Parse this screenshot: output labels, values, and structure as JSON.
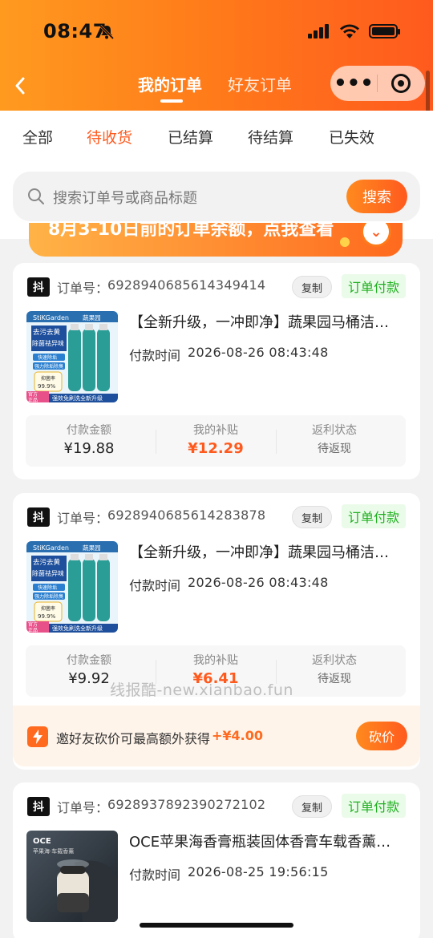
{
  "status_bar": {
    "time": "08:47"
  },
  "nav": {
    "tabs": [
      {
        "label": "我的订单",
        "active": true
      },
      {
        "label": "好友订单",
        "active": false
      }
    ]
  },
  "filter_tabs": [
    {
      "label": "全部"
    },
    {
      "label": "待收货",
      "active": true
    },
    {
      "label": "已结算"
    },
    {
      "label": "待结算"
    },
    {
      "label": "已失效"
    }
  ],
  "search": {
    "placeholder": "搜索订单号或商品标题",
    "button": "搜索"
  },
  "banner": {
    "text": "8月3-10日前的订单余额，点我查看"
  },
  "labels": {
    "order_no": "订单号：",
    "copy": "复制",
    "pay_time": "付款时间",
    "pay_amount": "付款金额",
    "subsidy": "我的补贴",
    "rebate_status": "返利状态",
    "platform_icon": "抖"
  },
  "orders": [
    {
      "order_no": "6928940685614349414",
      "status": "订单付款",
      "title": "【全新升级，一冲即净】蔬果园马桶洁…",
      "pay_time": "2026-08-26 08:43:48",
      "pay_amount": "¥19.88",
      "subsidy": "¥12.29",
      "rebate_status": "待返现"
    },
    {
      "order_no": "6928940685614283878",
      "status": "订单付款",
      "title": "【全新升级，一冲即净】蔬果园马桶洁…",
      "pay_time": "2026-08-26 08:43:48",
      "pay_amount": "¥9.92",
      "subsidy": "¥6.41",
      "rebate_status": "待返现"
    },
    {
      "order_no": "6928937892390272102",
      "status": "订单付款",
      "title": "OCE苹果海香膏瓶装固体香膏车载香薰…",
      "pay_time": "2026-08-25 19:56:15"
    }
  ],
  "product_image": {
    "brand": "StiKGarden",
    "brand_cn": "蔬果园",
    "line1": "去污去黄",
    "line2": "除菌祛异味",
    "tag1": "快速除垢",
    "tag2": "强力除垢除臭",
    "rate_label": "抑菌率",
    "rate": "99.9%",
    "official": "官方",
    "genuine": "正品",
    "footer": "强效免刷洗全新升级"
  },
  "product_image_3": {
    "brand": "OCE",
    "caption": "苹果海·车载香薰"
  },
  "invite": {
    "text": "邀好友砍价可最高额外获得",
    "amount": "+¥4.00",
    "button": "砍价"
  },
  "watermark": "线报酷-new.xianbao.fun",
  "colors": {
    "accent": "#ff5a1e",
    "status_green": "#20b020"
  }
}
